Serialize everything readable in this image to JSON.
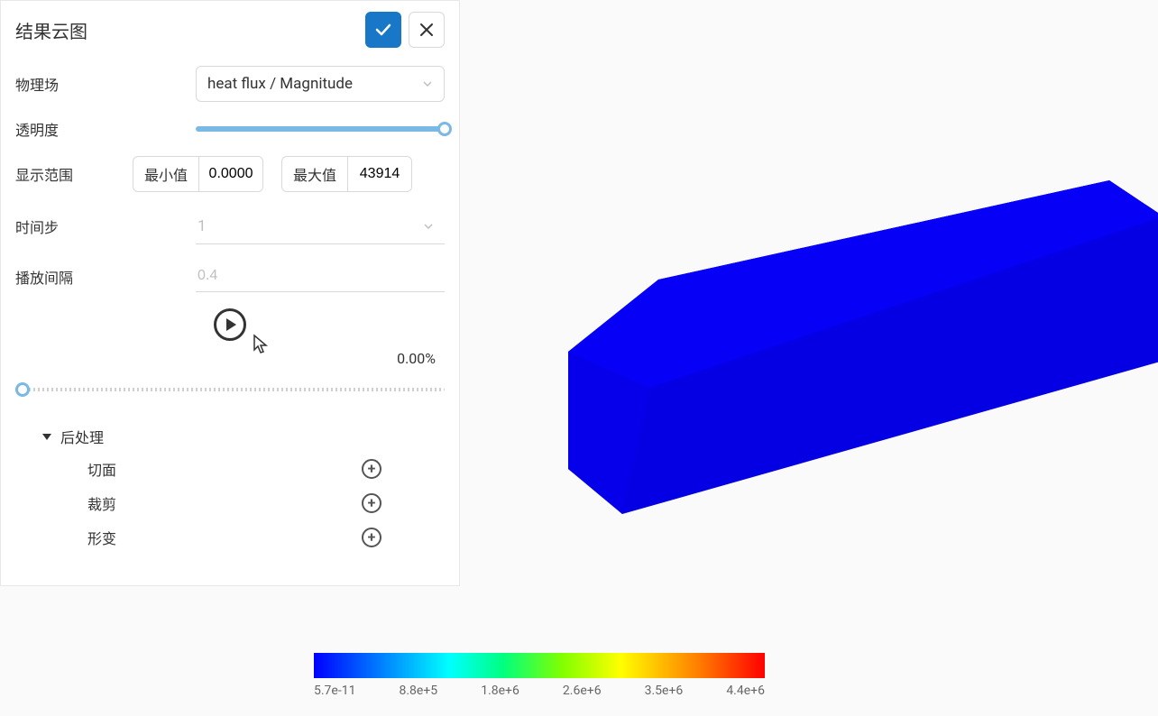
{
  "panel": {
    "title": "结果云图",
    "physics_field": {
      "label": "物理场",
      "value": "heat flux / Magnitude"
    },
    "opacity": {
      "label": "透明度"
    },
    "display_range": {
      "label": "显示范围",
      "min_label": "最小值",
      "min_value": "0.0000",
      "max_label": "最大值",
      "max_value": "43914"
    },
    "time_step": {
      "label": "时间步",
      "value": "1"
    },
    "play_interval": {
      "label": "播放间隔",
      "value": "0.4"
    },
    "progress": "0.00%",
    "postprocess": {
      "label": "后处理",
      "items": [
        {
          "label": "切面"
        },
        {
          "label": "裁剪"
        },
        {
          "label": "形变"
        }
      ]
    }
  },
  "colorbar": {
    "ticks": [
      "5.7e-11",
      "8.8e+5",
      "1.8e+6",
      "2.6e+6",
      "3.5e+6",
      "4.4e+6"
    ]
  }
}
